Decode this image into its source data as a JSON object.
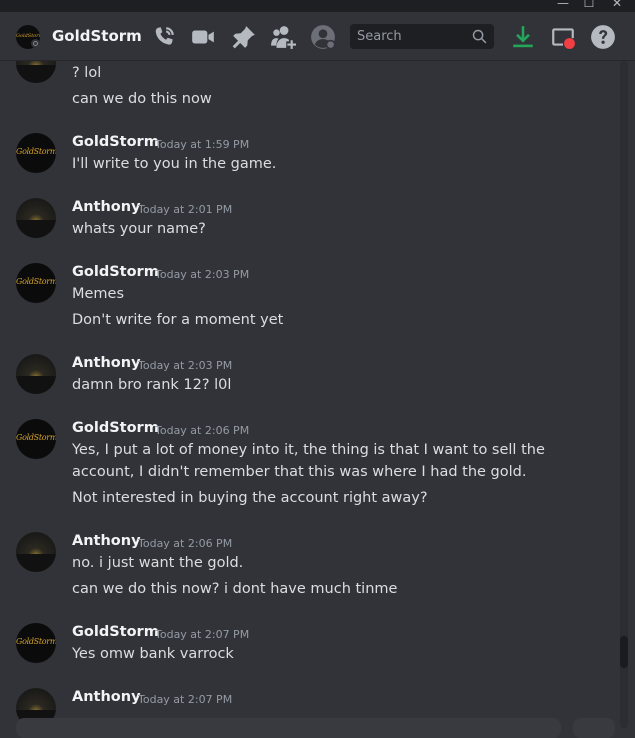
{
  "window": {
    "minimize": "—",
    "maximize": "☐",
    "close": "✕"
  },
  "header": {
    "channel_name": "GoldStorm",
    "avatar_logo": "GoldStorm",
    "search_placeholder": "Search"
  },
  "icons": {
    "call": "phone-call-icon",
    "video": "video-camera-icon",
    "pin": "pin-icon",
    "add_friend": "add-friend-icon",
    "profile": "user-profile-icon",
    "download": "download-icon",
    "screen": "screen-share-icon",
    "help": "help-icon"
  },
  "colors": {
    "download_green": "#23a55a",
    "alert_red": "#f23f43",
    "background": "#313338"
  },
  "messages": [
    {
      "lines": [
        "? lol",
        "can we do this now"
      ]
    },
    {
      "author": "GoldStorm",
      "timestamp": "Today at 1:59 PM",
      "lines": [
        "I'll write to you in the game."
      ]
    },
    {
      "author": "Anthony",
      "timestamp": "Today at 2:01 PM",
      "lines": [
        "whats your name?"
      ]
    },
    {
      "author": "GoldStorm",
      "timestamp": "Today at 2:03 PM",
      "lines": [
        "Memes",
        "Don't write for a moment yet"
      ]
    },
    {
      "author": "Anthony",
      "timestamp": "Today at 2:03 PM",
      "lines": [
        "damn bro rank 12? l0l"
      ]
    },
    {
      "author": "GoldStorm",
      "timestamp": "Today at 2:06 PM",
      "lines": [
        "Yes, I put a lot of money into it, the thing is that I want to sell the",
        "account, I didn't remember that this was where I had the gold.",
        "Not interested in buying the account right away?"
      ]
    },
    {
      "author": "Anthony",
      "timestamp": "Today at 2:06 PM",
      "lines": [
        "no. i just want the gold.",
        "can we do this now? i dont have much tinme"
      ]
    },
    {
      "author": "GoldStorm",
      "timestamp": "Today at 2:07 PM",
      "lines": [
        "Yes omw bank varrock"
      ]
    },
    {
      "author": "Anthony",
      "timestamp": "Today at 2:07 PM",
      "lines": []
    }
  ]
}
